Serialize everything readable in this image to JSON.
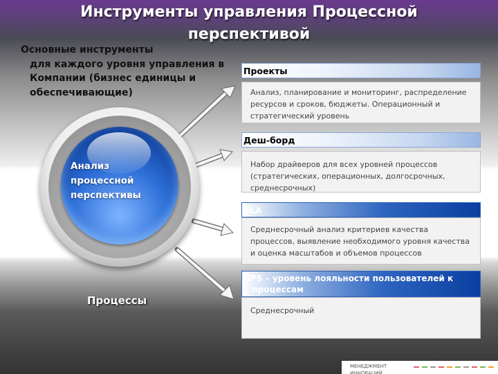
{
  "title_line1": "Инструменты управления Процессной",
  "title_line2": "перспективой",
  "subtitle_lines": [
    "Основные инструменты",
    "для каждого уровня управления в",
    "Компании (бизнес единицы и",
    "обеспечивающие)"
  ],
  "center": {
    "lines": [
      "Анализ",
      "процессной",
      "перспективы"
    ]
  },
  "process_label": "Процессы",
  "panels": [
    {
      "title": "Проекты",
      "style": "light",
      "lines": [
        "Анализ, планирование и мониторинг,  распределение",
        "ресурсов и сроков, бюджеты. Операционный  и",
        "стратегический уровень"
      ]
    },
    {
      "title": "Деш-борд",
      "style": "light",
      "lines": [
        "Набор драйверов для всех уровней процессов",
        "(стратегических, операционных, долгосрочных,",
        "среднесрочных)"
      ]
    },
    {
      "title": "SLA",
      "style": "dark",
      "lines": [
        "Среднесрочный  анализ критериев качества",
        "процессов, выявление необходимого уровня качества",
        "и оценка масштабов  и объемов процессов"
      ]
    },
    {
      "title_lines": [
        "NPS – уровень лояльности пользователей к",
        "   процессам"
      ],
      "style": "dark",
      "lines": [
        "Среднесрочный"
      ]
    }
  ],
  "footer": "МЕНЕДЖМЕНТ ИННОВАЦИЙ",
  "colors": {
    "accent_blue": "#0a3fa0",
    "orb_blue": "#2d6fd8",
    "title_purple": "#6a3a8e"
  }
}
